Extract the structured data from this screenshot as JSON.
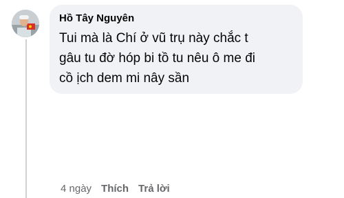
{
  "comment": {
    "author": "Hồ Tây Nguyên",
    "text": "Tui mà là Chí ở vũ trụ này chắc t\ngâu tu đờ hóp bi tồ tu nêu ô me đi\ncồ ịch dem mi nây sần",
    "avatar_icon": "profile-photo-avatar"
  },
  "actions": {
    "time": "4 ngày",
    "like": "Thích",
    "reply": "Trả lời"
  },
  "colors": {
    "bubble": "#f0f2f5",
    "text": "#050505",
    "secondary": "#65676b",
    "thread_line": "#ced0d4"
  }
}
